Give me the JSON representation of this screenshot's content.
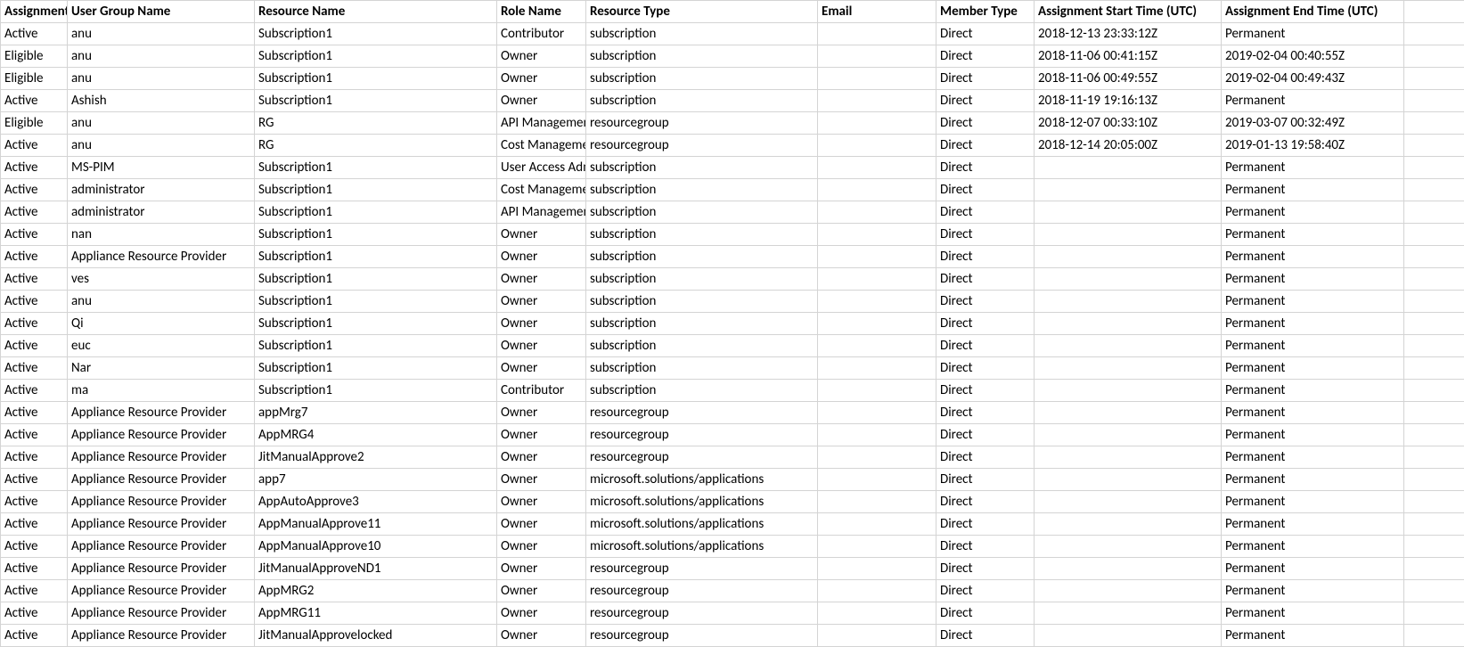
{
  "headers": {
    "assignment": "Assignment",
    "userGroup": "User Group Name",
    "resourceName": "Resource Name",
    "roleName": "Role Name",
    "resourceType": "Resource Type",
    "email": "Email",
    "memberType": "Member Type",
    "startTime": "Assignment Start Time (UTC)",
    "endTime": "Assignment End Time (UTC)"
  },
  "rows": [
    {
      "assignment": "Active",
      "userGroup": "anu",
      "resourceName": "Subscription1",
      "roleName": "Contributor",
      "resourceType": "subscription",
      "email": "",
      "memberType": "Direct",
      "startTime": "2018-12-13 23:33:12Z",
      "endTime": "Permanent"
    },
    {
      "assignment": "Eligible",
      "userGroup": "anu",
      "resourceName": "Subscription1",
      "roleName": "Owner",
      "resourceType": "subscription",
      "email": "",
      "memberType": "Direct",
      "startTime": "2018-11-06 00:41:15Z",
      "endTime": "2019-02-04 00:40:55Z"
    },
    {
      "assignment": "Eligible",
      "userGroup": "anu",
      "resourceName": "Subscription1",
      "roleName": "Owner",
      "resourceType": "subscription",
      "email": "",
      "memberType": "Direct",
      "startTime": "2018-11-06 00:49:55Z",
      "endTime": "2019-02-04 00:49:43Z"
    },
    {
      "assignment": "Active",
      "userGroup": "Ashish",
      "resourceName": "Subscription1",
      "roleName": "Owner",
      "resourceType": "subscription",
      "email": "",
      "memberType": "Direct",
      "startTime": "2018-11-19 19:16:13Z",
      "endTime": "Permanent"
    },
    {
      "assignment": "Eligible",
      "userGroup": "anu",
      "resourceName": "RG",
      "roleName": "API Management",
      "resourceType": "resourcegroup",
      "email": "",
      "memberType": "Direct",
      "startTime": "2018-12-07 00:33:10Z",
      "endTime": "2019-03-07 00:32:49Z"
    },
    {
      "assignment": "Active",
      "userGroup": "anu",
      "resourceName": "RG",
      "roleName": "Cost Management",
      "resourceType": "resourcegroup",
      "email": "",
      "memberType": "Direct",
      "startTime": "2018-12-14 20:05:00Z",
      "endTime": "2019-01-13 19:58:40Z"
    },
    {
      "assignment": "Active",
      "userGroup": "MS-PIM",
      "resourceName": "Subscription1",
      "roleName": "User Access Administrator",
      "resourceType": "subscription",
      "email": "",
      "memberType": "Direct",
      "startTime": "",
      "endTime": "Permanent"
    },
    {
      "assignment": "Active",
      "userGroup": "administrator",
      "resourceName": "Subscription1",
      "roleName": "Cost Management",
      "resourceType": "subscription",
      "email": "",
      "memberType": "Direct",
      "startTime": "",
      "endTime": "Permanent"
    },
    {
      "assignment": "Active",
      "userGroup": "administrator",
      "resourceName": "Subscription1",
      "roleName": "API Management",
      "resourceType": "subscription",
      "email": "",
      "memberType": "Direct",
      "startTime": "",
      "endTime": "Permanent"
    },
    {
      "assignment": "Active",
      "userGroup": "nan",
      "resourceName": "Subscription1",
      "roleName": "Owner",
      "resourceType": "subscription",
      "email": "",
      "memberType": "Direct",
      "startTime": "",
      "endTime": "Permanent"
    },
    {
      "assignment": "Active",
      "userGroup": "Appliance Resource Provider",
      "resourceName": "Subscription1",
      "roleName": "Owner",
      "resourceType": "subscription",
      "email": "",
      "memberType": "Direct",
      "startTime": "",
      "endTime": "Permanent"
    },
    {
      "assignment": "Active",
      "userGroup": "ves",
      "resourceName": "Subscription1",
      "roleName": "Owner",
      "resourceType": "subscription",
      "email": "",
      "memberType": "Direct",
      "startTime": "",
      "endTime": "Permanent"
    },
    {
      "assignment": "Active",
      "userGroup": "anu",
      "resourceName": "Subscription1",
      "roleName": "Owner",
      "resourceType": "subscription",
      "email": "",
      "memberType": "Direct",
      "startTime": "",
      "endTime": "Permanent"
    },
    {
      "assignment": "Active",
      "userGroup": "Qi",
      "resourceName": "Subscription1",
      "roleName": "Owner",
      "resourceType": "subscription",
      "email": "",
      "memberType": "Direct",
      "startTime": "",
      "endTime": "Permanent"
    },
    {
      "assignment": "Active",
      "userGroup": "euc",
      "resourceName": "Subscription1",
      "roleName": "Owner",
      "resourceType": "subscription",
      "email": "",
      "memberType": "Direct",
      "startTime": "",
      "endTime": "Permanent"
    },
    {
      "assignment": "Active",
      "userGroup": "Nar",
      "resourceName": "Subscription1",
      "roleName": "Owner",
      "resourceType": "subscription",
      "email": "",
      "memberType": "Direct",
      "startTime": "",
      "endTime": "Permanent"
    },
    {
      "assignment": "Active",
      "userGroup": "ma",
      "resourceName": "Subscription1",
      "roleName": "Contributor",
      "resourceType": "subscription",
      "email": "",
      "memberType": "Direct",
      "startTime": "",
      "endTime": "Permanent"
    },
    {
      "assignment": "Active",
      "userGroup": "Appliance Resource Provider",
      "resourceName": "appMrg7",
      "roleName": "Owner",
      "resourceType": "resourcegroup",
      "email": "",
      "memberType": "Direct",
      "startTime": "",
      "endTime": "Permanent"
    },
    {
      "assignment": "Active",
      "userGroup": "Appliance Resource Provider",
      "resourceName": "AppMRG4",
      "roleName": "Owner",
      "resourceType": "resourcegroup",
      "email": "",
      "memberType": "Direct",
      "startTime": "",
      "endTime": "Permanent"
    },
    {
      "assignment": "Active",
      "userGroup": "Appliance Resource Provider",
      "resourceName": "JitManualApprove2",
      "roleName": "Owner",
      "resourceType": "resourcegroup",
      "email": "",
      "memberType": "Direct",
      "startTime": "",
      "endTime": "Permanent"
    },
    {
      "assignment": "Active",
      "userGroup": "Appliance Resource Provider",
      "resourceName": "app7",
      "roleName": "Owner",
      "resourceType": "microsoft.solutions/applications",
      "email": "",
      "memberType": "Direct",
      "startTime": "",
      "endTime": "Permanent"
    },
    {
      "assignment": "Active",
      "userGroup": "Appliance Resource Provider",
      "resourceName": "AppAutoApprove3",
      "roleName": "Owner",
      "resourceType": "microsoft.solutions/applications",
      "email": "",
      "memberType": "Direct",
      "startTime": "",
      "endTime": "Permanent"
    },
    {
      "assignment": "Active",
      "userGroup": "Appliance Resource Provider",
      "resourceName": "AppManualApprove11",
      "roleName": "Owner",
      "resourceType": "microsoft.solutions/applications",
      "email": "",
      "memberType": "Direct",
      "startTime": "",
      "endTime": "Permanent"
    },
    {
      "assignment": "Active",
      "userGroup": "Appliance Resource Provider",
      "resourceName": "AppManualApprove10",
      "roleName": "Owner",
      "resourceType": "microsoft.solutions/applications",
      "email": "",
      "memberType": "Direct",
      "startTime": "",
      "endTime": "Permanent"
    },
    {
      "assignment": "Active",
      "userGroup": "Appliance Resource Provider",
      "resourceName": "JitManualApproveND1",
      "roleName": "Owner",
      "resourceType": "resourcegroup",
      "email": "",
      "memberType": "Direct",
      "startTime": "",
      "endTime": "Permanent"
    },
    {
      "assignment": "Active",
      "userGroup": "Appliance Resource Provider",
      "resourceName": "AppMRG2",
      "roleName": "Owner",
      "resourceType": "resourcegroup",
      "email": "",
      "memberType": "Direct",
      "startTime": "",
      "endTime": "Permanent"
    },
    {
      "assignment": "Active",
      "userGroup": "Appliance Resource Provider",
      "resourceName": "AppMRG11",
      "roleName": "Owner",
      "resourceType": "resourcegroup",
      "email": "",
      "memberType": "Direct",
      "startTime": "",
      "endTime": "Permanent"
    },
    {
      "assignment": "Active",
      "userGroup": "Appliance Resource Provider",
      "resourceName": "JitManualApprovelocked",
      "roleName": "Owner",
      "resourceType": "resourcegroup",
      "email": "",
      "memberType": "Direct",
      "startTime": "",
      "endTime": "Permanent"
    }
  ]
}
